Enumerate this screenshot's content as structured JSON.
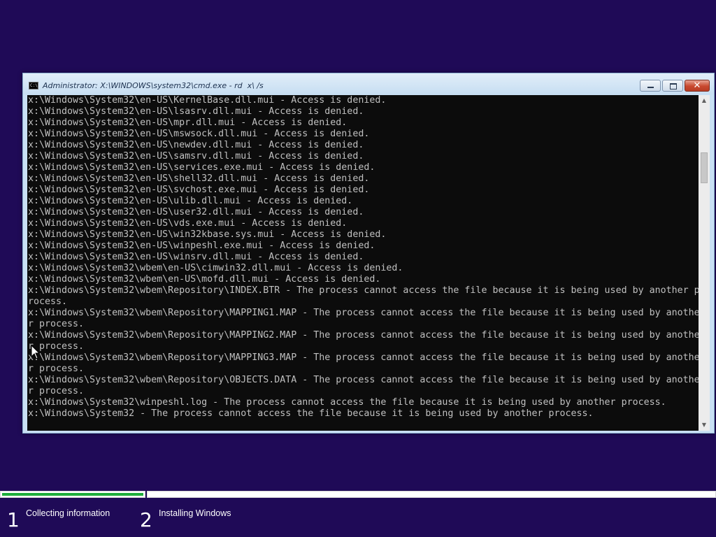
{
  "window": {
    "title": "Administrator: X:\\WINDOWS\\system32\\cmd.exe - rd  x\\ /s",
    "icon": "cmd-icon",
    "icon_text": "C:\\",
    "controls": {
      "minimize_icon": "minimize-icon",
      "maximize_icon": "maximize-icon",
      "close_icon": "close-icon",
      "close_glyph": "✕"
    }
  },
  "console": {
    "lines": [
      "x:\\Windows\\System32\\en-US\\KernelBase.dll.mui - Access is denied.",
      "x:\\Windows\\System32\\en-US\\lsasrv.dll.mui - Access is denied.",
      "x:\\Windows\\System32\\en-US\\mpr.dll.mui - Access is denied.",
      "x:\\Windows\\System32\\en-US\\mswsock.dll.mui - Access is denied.",
      "x:\\Windows\\System32\\en-US\\newdev.dll.mui - Access is denied.",
      "x:\\Windows\\System32\\en-US\\samsrv.dll.mui - Access is denied.",
      "x:\\Windows\\System32\\en-US\\services.exe.mui - Access is denied.",
      "x:\\Windows\\System32\\en-US\\shell32.dll.mui - Access is denied.",
      "x:\\Windows\\System32\\en-US\\svchost.exe.mui - Access is denied.",
      "x:\\Windows\\System32\\en-US\\ulib.dll.mui - Access is denied.",
      "x:\\Windows\\System32\\en-US\\user32.dll.mui - Access is denied.",
      "x:\\Windows\\System32\\en-US\\vds.exe.mui - Access is denied.",
      "x:\\Windows\\System32\\en-US\\win32kbase.sys.mui - Access is denied.",
      "x:\\Windows\\System32\\en-US\\winpeshl.exe.mui - Access is denied.",
      "x:\\Windows\\System32\\en-US\\winsrv.dll.mui - Access is denied.",
      "x:\\Windows\\System32\\wbem\\en-US\\cimwin32.dll.mui - Access is denied.",
      "x:\\Windows\\System32\\wbem\\en-US\\mofd.dll.mui - Access is denied.",
      "x:\\Windows\\System32\\wbem\\Repository\\INDEX.BTR - The process cannot access the file because it is being used by another p",
      "rocess.",
      "x:\\Windows\\System32\\wbem\\Repository\\MAPPING1.MAP - The process cannot access the file because it is being used by anothe",
      "r process.",
      "x:\\Windows\\System32\\wbem\\Repository\\MAPPING2.MAP - The process cannot access the file because it is being used by anothe",
      "r process.",
      "x:\\Windows\\System32\\wbem\\Repository\\MAPPING3.MAP - The process cannot access the file because it is being used by anothe",
      "r process.",
      "x:\\Windows\\System32\\wbem\\Repository\\OBJECTS.DATA - The process cannot access the file because it is being used by anothe",
      "r process.",
      "x:\\Windows\\System32\\winpeshl.log - The process cannot access the file because it is being used by another process.",
      "x:\\Windows\\System32 - The process cannot access the file because it is being used by another process."
    ]
  },
  "scrollbar": {
    "up_icon": "scroll-up-arrow-icon",
    "down_icon": "scroll-down-arrow-icon",
    "up_glyph": "▲",
    "down_glyph": "▼"
  },
  "setup": {
    "progress": {
      "step1_fill_fraction": 0.99,
      "fill_color": "#1ead3a"
    },
    "steps": [
      {
        "number": "1",
        "label": "Collecting information"
      },
      {
        "number": "2",
        "label": "Installing Windows"
      }
    ]
  },
  "colors": {
    "background": "#1f0a57",
    "console_bg": "#0c0c0c",
    "console_text": "#c0c0c0"
  },
  "cursor": {
    "icon": "mouse-pointer-icon"
  }
}
